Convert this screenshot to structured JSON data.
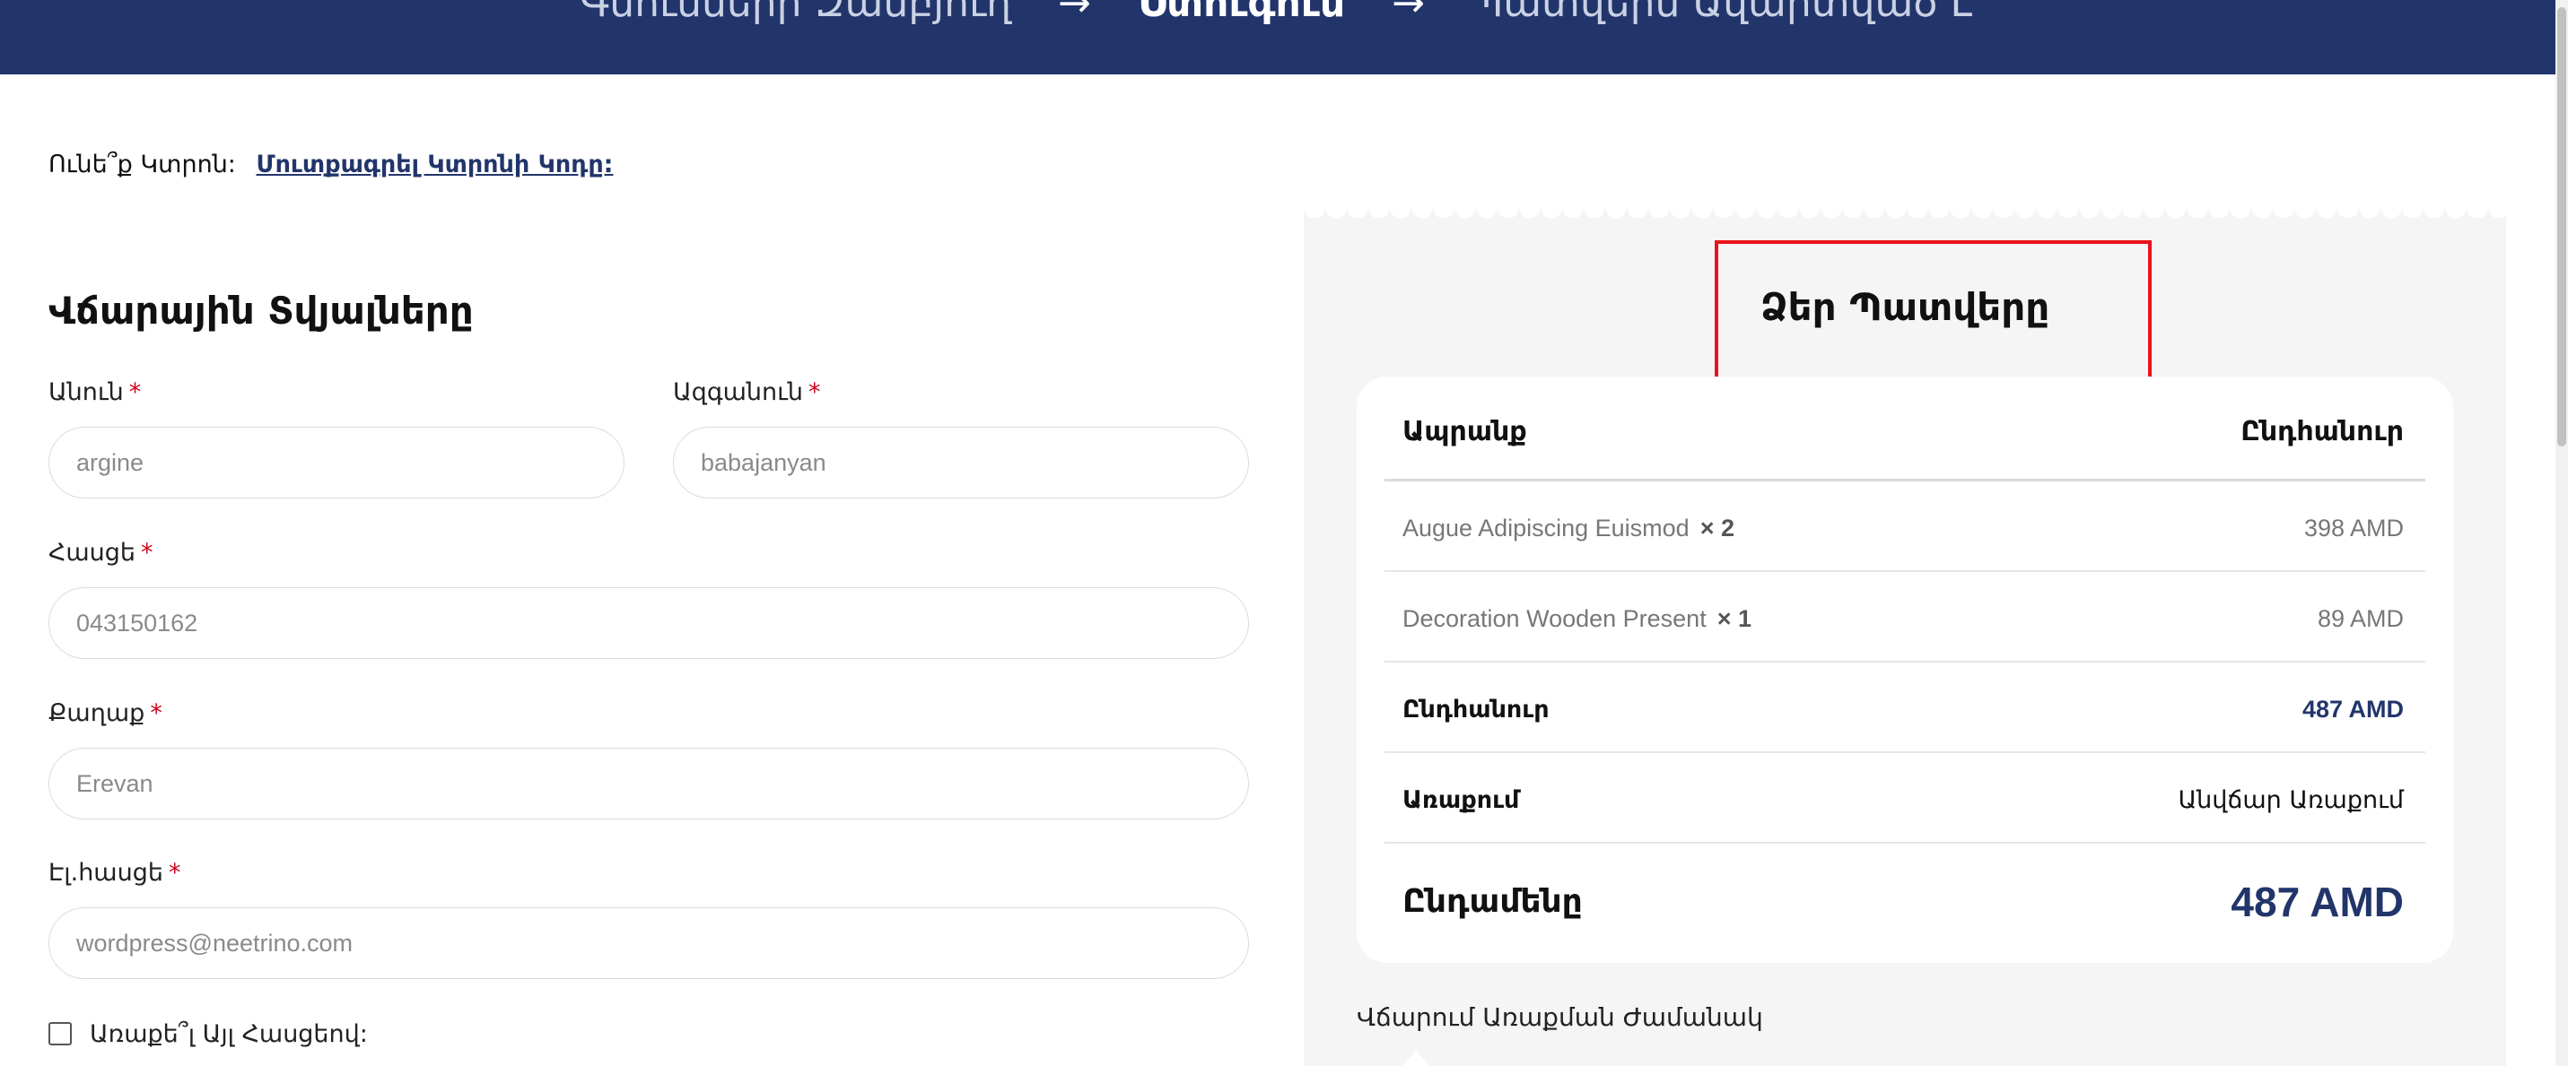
{
  "steps": {
    "step1": "Գնումների Զամբյուղ",
    "step2": "Ստուգում",
    "step3": "Պատվերն Ավարտված Է",
    "arrow": "→"
  },
  "coupon": {
    "question": "Ունե՞ք Կտրոն:",
    "link": "Մուտքագրել Կտրոնի Կոդը:"
  },
  "billing": {
    "title": "Վճարային Տվյալները",
    "first_name": {
      "label": "Անուն",
      "value": "argine"
    },
    "last_name": {
      "label": "Ազգանուն",
      "value": "babajanyan"
    },
    "phone": {
      "label": "Հասցե",
      "value": "043150162"
    },
    "city": {
      "label": "Քաղաք",
      "value": "Erevan"
    },
    "email": {
      "label": "Էլ.հասցե",
      "value": "wordpress@neetrino.com"
    },
    "required_mark": "*",
    "ship_different": "Առաքե՞լ Այլ Հասցեով:"
  },
  "order": {
    "title": "Ձեր Պատվերը",
    "col_product": "Ապրանք",
    "col_total": "Ընդհանուր",
    "items": [
      {
        "name": "Augue Adipiscing Euismod",
        "qty": "× 2",
        "price": "398 AMD"
      },
      {
        "name": "Decoration Wooden Present",
        "qty": "× 1",
        "price": "89 AMD"
      }
    ],
    "subtotal_label": "Ընդհանուր",
    "subtotal_value": "487 AMD",
    "shipping_label": "Առաքում",
    "shipping_value": "Անվճար Առաքում",
    "total_label": "Ընդամենը",
    "total_value": "487 AMD",
    "payment_method": "Վճարում Առաքման Ժամանակ"
  },
  "colors": {
    "brand_navy": "#22356b",
    "required_red": "#d0021b",
    "highlight_red": "#e8131b",
    "panel_gray": "#f5f5f5"
  }
}
